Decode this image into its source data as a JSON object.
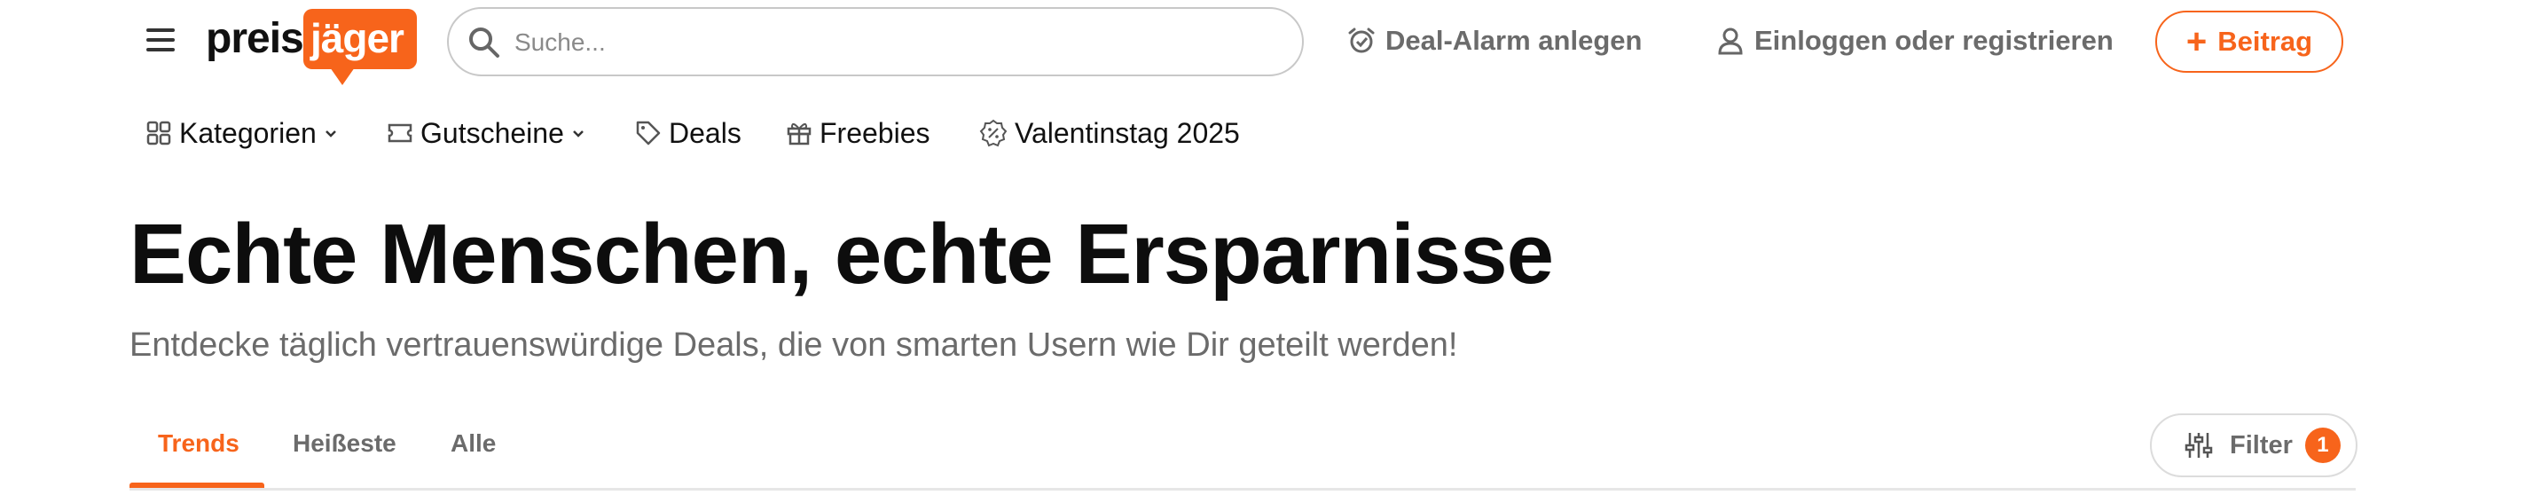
{
  "header": {
    "menu_icon": "hamburger-icon",
    "logo": {
      "part1": "preis",
      "part2": "jäger"
    },
    "search": {
      "placeholder": "Suche..."
    },
    "deal_alarm_label": "Deal-Alarm anlegen",
    "login_label": "Einloggen oder registrieren",
    "post_button_label": "Beitrag"
  },
  "nav": {
    "items": [
      {
        "label": "Kategorien",
        "icon": "grid-icon",
        "dropdown": true
      },
      {
        "label": "Gutscheine",
        "icon": "ticket-icon",
        "dropdown": true
      },
      {
        "label": "Deals",
        "icon": "tag-icon"
      },
      {
        "label": "Freebies",
        "icon": "gift-icon"
      },
      {
        "label": "Valentinstag 2025",
        "icon": "percent-badge-icon"
      }
    ]
  },
  "hero": {
    "title": "Echte Menschen, echte Ersparnisse",
    "subtitle": "Entdecke täglich vertrauenswürdige Deals, die von smarten Usern wie Dir geteilt werden!"
  },
  "tabs": {
    "items": [
      "Trends",
      "Heißeste",
      "Alle"
    ],
    "active": "Trends"
  },
  "filter": {
    "label": "Filter",
    "count": "1"
  },
  "colors": {
    "accent": "#f7641b",
    "text": "#111111",
    "muted": "#6b6b6b"
  }
}
